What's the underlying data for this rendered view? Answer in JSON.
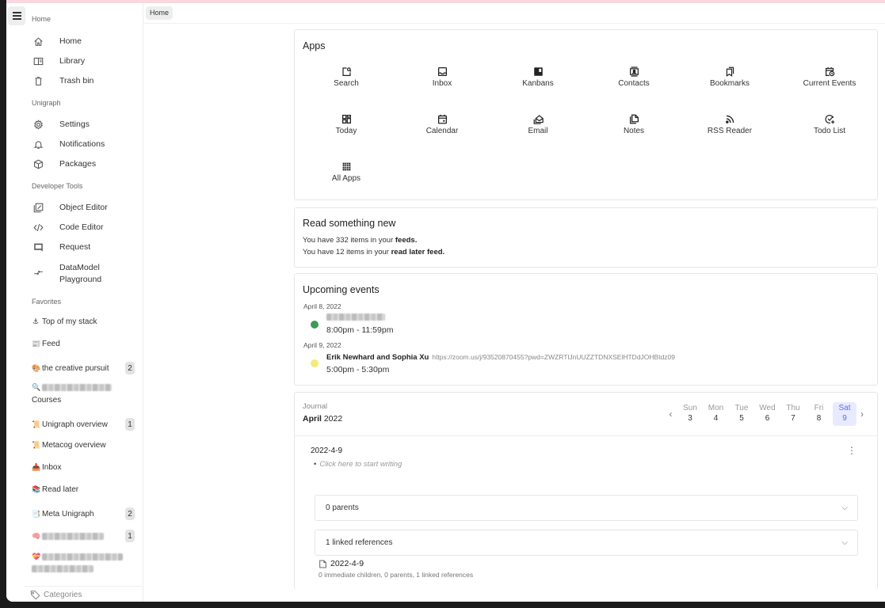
{
  "sidebar": {
    "sections": {
      "home": "Home",
      "unigraph": "Unigraph",
      "devtools": "Developer Tools",
      "favorites": "Favorites"
    },
    "home_items": [
      {
        "label": "Home",
        "icon": "home-icon"
      },
      {
        "label": "Library",
        "icon": "library-icon"
      },
      {
        "label": "Trash bin",
        "icon": "trash-icon"
      }
    ],
    "unigraph_items": [
      {
        "label": "Settings",
        "icon": "gear-icon"
      },
      {
        "label": "Notifications",
        "icon": "bell-icon"
      },
      {
        "label": "Packages",
        "icon": "package-icon"
      }
    ],
    "devtools_items": [
      {
        "label": "Object Editor",
        "icon": "object-editor-icon"
      },
      {
        "label": "Code Editor",
        "icon": "code-icon"
      },
      {
        "label": "Request",
        "icon": "comment-icon"
      },
      {
        "label": "DataModel Playground",
        "icon": "compare-arrows-icon"
      }
    ],
    "favorites": [
      {
        "emoji": "⚓",
        "label": "Top of my stack",
        "badge": null
      },
      {
        "emoji": "📰",
        "label": "Feed",
        "badge": null
      },
      {
        "emoji": "🎨",
        "label": "the creative pursuit",
        "badge": "2"
      },
      {
        "emoji": "🔍",
        "label": "Courses",
        "badge": null,
        "blurred_prefix": true
      },
      {
        "emoji": "📜",
        "label": "Unigraph overview",
        "badge": "1"
      },
      {
        "emoji": "📜",
        "label": "Metacog overview",
        "badge": null
      },
      {
        "emoji": "📥",
        "label": "Inbox",
        "badge": null
      },
      {
        "emoji": "📚",
        "label": "Read later",
        "badge": null
      },
      {
        "emoji": "📑",
        "label": "Meta Unigraph",
        "badge": "2"
      },
      {
        "emoji": "🧠",
        "label": "",
        "badge": "1",
        "blurred": true
      },
      {
        "emoji": "💝",
        "label": "",
        "badge": null,
        "blurred": true
      }
    ],
    "categories_label": "Categories"
  },
  "breadcrumb": {
    "current": "Home"
  },
  "apps": {
    "title": "Apps",
    "items": [
      {
        "label": "Search",
        "icon": "search-icon"
      },
      {
        "label": "Inbox",
        "icon": "inbox-icon"
      },
      {
        "label": "Kanbans",
        "icon": "kanban-icon"
      },
      {
        "label": "Contacts",
        "icon": "contacts-icon"
      },
      {
        "label": "Bookmarks",
        "icon": "bookmarks-icon"
      },
      {
        "label": "Current Events",
        "icon": "calendar-clock-icon"
      },
      {
        "label": "Today",
        "icon": "dashboard-icon"
      },
      {
        "label": "Calendar",
        "icon": "calendar-icon"
      },
      {
        "label": "Email",
        "icon": "email-icon"
      },
      {
        "label": "Notes",
        "icon": "notes-icon"
      },
      {
        "label": "RSS Reader",
        "icon": "rss-icon"
      },
      {
        "label": "Todo List",
        "icon": "todo-icon"
      },
      {
        "label": "All Apps",
        "icon": "grid-icon"
      }
    ]
  },
  "read": {
    "title": "Read something new",
    "line1_prefix": "You have 332 items in your ",
    "line1_bold": "feeds.",
    "line2_prefix": "You have 12 items in your ",
    "line2_bold": "read later feed."
  },
  "events": {
    "title": "Upcoming events",
    "groups": [
      {
        "date": "April 8, 2022",
        "items": [
          {
            "title": "",
            "blurred": true,
            "link": "",
            "time": "8:00pm - 11:59pm",
            "color": "#3a9b57"
          }
        ]
      },
      {
        "date": "April 9, 2022",
        "items": [
          {
            "title": "Erik Newhard and Sophia Xu",
            "link": "https://zoom.us/j/93520870455?pwd=ZWZRTlJnUUZZTDNXSElHTDdJOHBtdz09",
            "time": "5:00pm - 5:30pm",
            "color": "#f2ea7a"
          }
        ]
      }
    ]
  },
  "journal": {
    "label": "Journal",
    "month_bold": "April",
    "year": "2022",
    "days": [
      {
        "dow": "Sun",
        "num": "3",
        "selected": false
      },
      {
        "dow": "Mon",
        "num": "4",
        "selected": false
      },
      {
        "dow": "Tue",
        "num": "5",
        "selected": false
      },
      {
        "dow": "Wed",
        "num": "6",
        "selected": false
      },
      {
        "dow": "Thu",
        "num": "7",
        "selected": false
      },
      {
        "dow": "Fri",
        "num": "8",
        "selected": false
      },
      {
        "dow": "Sat",
        "num": "9",
        "selected": true
      }
    ],
    "entry_date": "2022-4-9",
    "placeholder": "Click here to start writing",
    "parents_label": "0 parents",
    "linked_label": "1 linked references",
    "ref_title": "2022-4-9",
    "ref_sub": "0 immediate children, 0 parents, 1 linked references"
  },
  "colors": {
    "accent": "#5e6ef0",
    "selected_day_bg": "#e8ebff",
    "event_green": "#3a9b57",
    "event_yellow": "#f2ea7a"
  }
}
